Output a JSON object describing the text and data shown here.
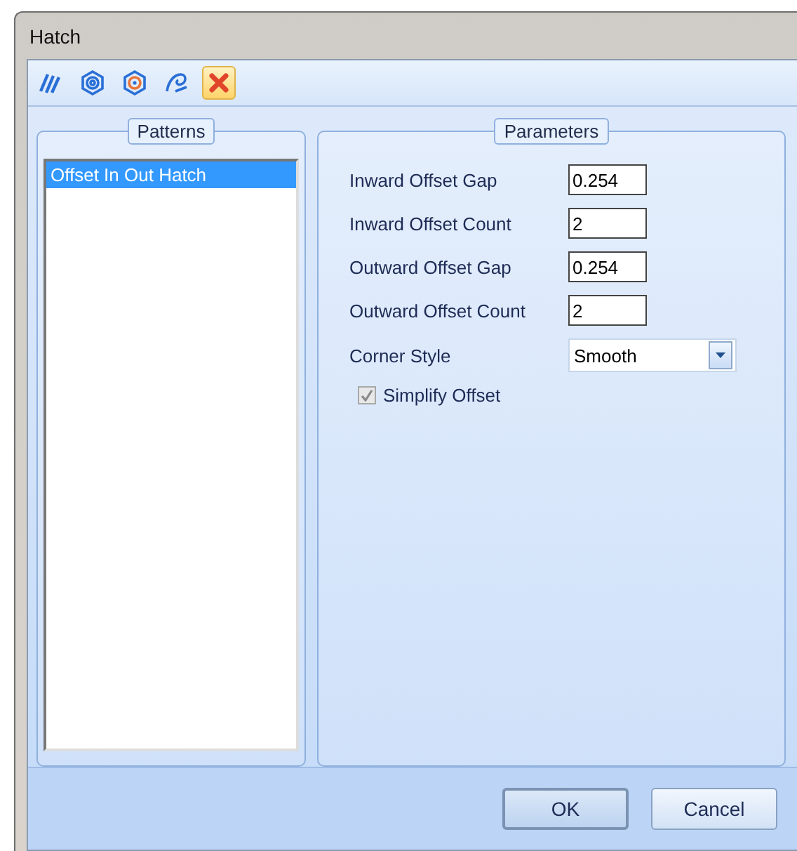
{
  "window": {
    "title": "Hatch"
  },
  "toolbar": [
    {
      "kind": "lines",
      "selected": false
    },
    {
      "kind": "hexagon",
      "selected": false
    },
    {
      "kind": "hexagon-orange",
      "selected": false
    },
    {
      "kind": "spiral",
      "selected": false
    },
    {
      "kind": "delete",
      "selected": true
    }
  ],
  "patterns": {
    "title": "Patterns",
    "items": [
      {
        "label": "Offset In Out Hatch",
        "selected": true
      }
    ]
  },
  "parameters": {
    "title": "Parameters",
    "fields": [
      {
        "kind": "text",
        "label": "Inward Offset Gap",
        "value": "0.254"
      },
      {
        "kind": "text",
        "label": "Inward Offset Count",
        "value": "2"
      },
      {
        "kind": "text",
        "label": "Outward Offset Gap",
        "value": "0.254"
      },
      {
        "kind": "text",
        "label": "Outward Offset Count",
        "value": "2"
      },
      {
        "kind": "dropdown",
        "label": "Corner Style",
        "value": "Smooth"
      }
    ],
    "checkbox": {
      "label": "Simplify Offset",
      "checked": true,
      "disabled": true
    }
  },
  "buttons": [
    {
      "label": "OK",
      "default": true
    },
    {
      "label": "Cancel",
      "default": false
    }
  ]
}
